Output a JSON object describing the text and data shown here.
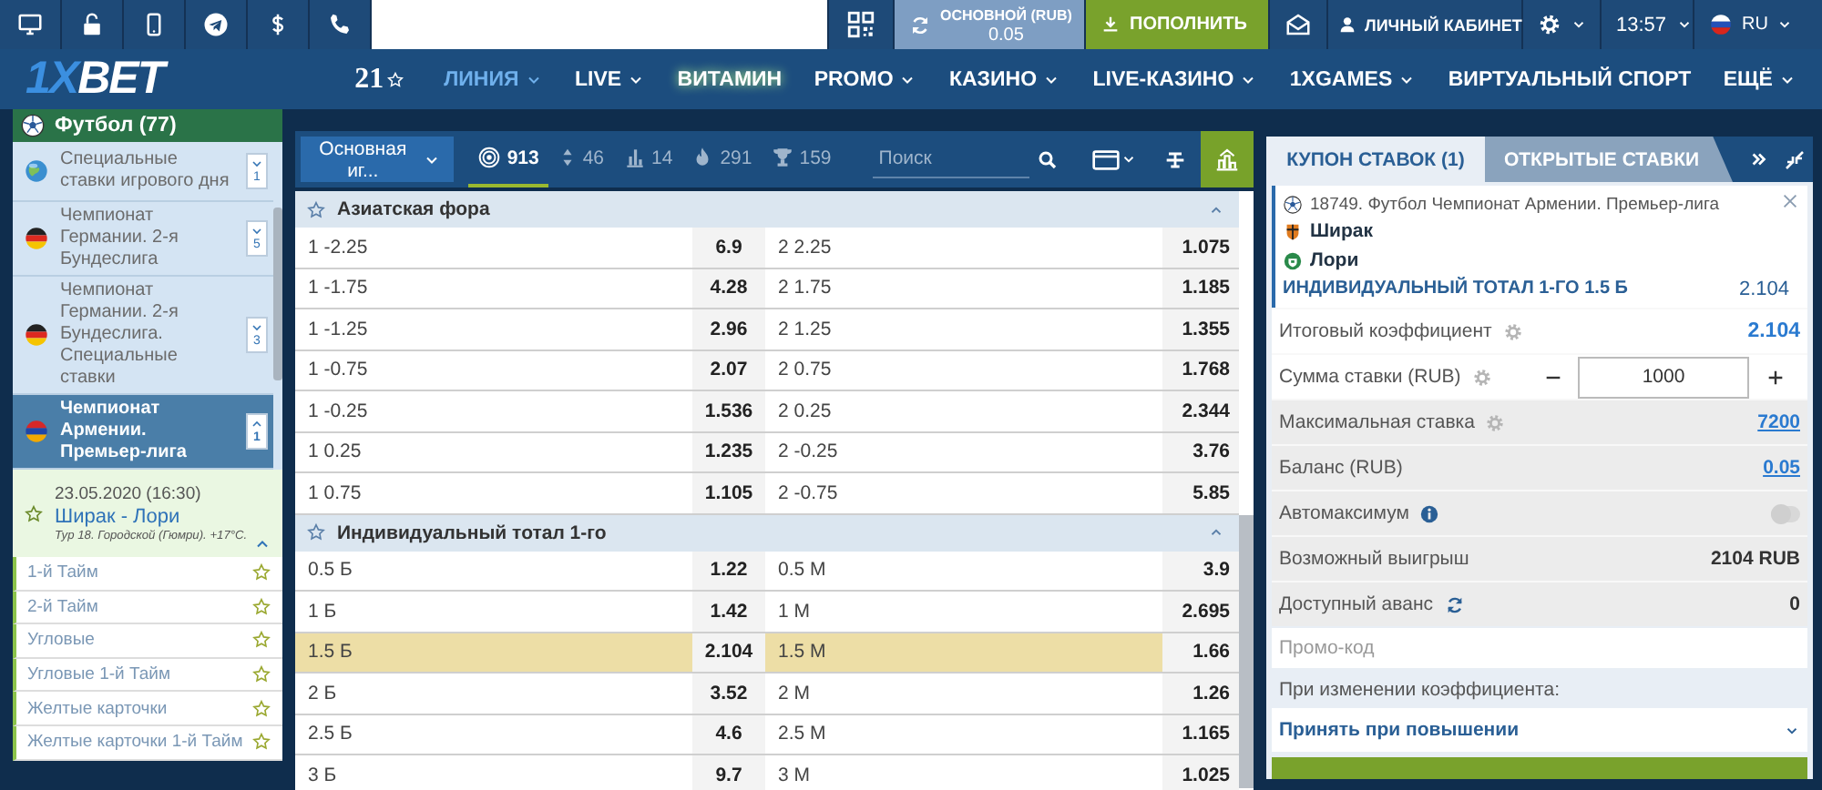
{
  "top_bar": {
    "balance": {
      "label": "ОСНОВНОЙ (RUB)",
      "value": "0.05"
    },
    "deposit": "ПОПОЛНИТЬ",
    "cabinet": "ЛИЧНЫЙ КАБИНЕТ",
    "time": "13:57",
    "language": "RU"
  },
  "nav": {
    "logo": {
      "accent": "1X",
      "rest": "BET"
    },
    "badge": "21",
    "items": [
      {
        "label": "ЛИНИЯ",
        "selected": true,
        "dropdown": true
      },
      {
        "label": "LIVE",
        "selected": false,
        "dropdown": true
      },
      {
        "label": "ВИТАМИН",
        "selected": false,
        "dropdown": false
      },
      {
        "label": "PROMO",
        "selected": false,
        "dropdown": true
      },
      {
        "label": "КАЗИНО",
        "selected": false,
        "dropdown": true
      },
      {
        "label": "LIVE-КАЗИНО",
        "selected": false,
        "dropdown": true
      },
      {
        "label": "1XGAMES",
        "selected": false,
        "dropdown": true
      },
      {
        "label": "ВИРТУАЛЬНЫЙ СПОРТ",
        "selected": false,
        "dropdown": false
      },
      {
        "label": "ЕЩЁ",
        "selected": false,
        "dropdown": true
      }
    ]
  },
  "sidebar": {
    "sport": "Футбол (77)",
    "leagues": [
      {
        "name": "Специальные ставки игрового дня",
        "kind": "globe",
        "count": "1",
        "expanded": false,
        "selected": false
      },
      {
        "name": "Чемпионат Германии. 2-я Бундеслига",
        "kind": "germany",
        "count": "5",
        "expanded": false,
        "selected": false
      },
      {
        "name": "Чемпионат Германии. 2-я Бундеслига. Специальные ставки",
        "kind": "germany",
        "count": "3",
        "expanded": false,
        "selected": false
      },
      {
        "name": "Чемпионат Армении. Премьер-лига",
        "kind": "armenia",
        "count": "1",
        "expanded": true,
        "selected": true
      }
    ],
    "match": {
      "date": "23.05.2020 (16:30)",
      "teams": "Ширак - Лори",
      "info": "Тур 18. Городской (Гюмри). +17°C."
    },
    "submarkets": [
      "1-й Тайм",
      "2-й Тайм",
      "Угловые",
      "Угловые 1-й Тайм",
      "Желтые карточки",
      "Желтые карточки 1-й Тайм"
    ]
  },
  "toolbar": {
    "mode": "Основная иг...",
    "filters": [
      {
        "kind": "target",
        "count": "913",
        "selected": true
      },
      {
        "kind": "updown",
        "count": "46",
        "selected": false
      },
      {
        "kind": "chart",
        "count": "14",
        "selected": false
      },
      {
        "kind": "fire",
        "count": "291",
        "selected": false
      },
      {
        "kind": "trophy",
        "count": "159",
        "selected": false
      }
    ],
    "search": {
      "placeholder": "Поиск"
    }
  },
  "markets": [
    {
      "title": "Азиатская фора",
      "expanded": true,
      "rows": [
        {
          "left": "1 -2.25",
          "left_odds": "6.9",
          "right": "2 2.25",
          "right_odds": "1.075",
          "selected": false
        },
        {
          "left": "1 -1.75",
          "left_odds": "4.28",
          "right": "2 1.75",
          "right_odds": "1.185",
          "selected": false
        },
        {
          "left": "1 -1.25",
          "left_odds": "2.96",
          "right": "2 1.25",
          "right_odds": "1.355",
          "selected": false
        },
        {
          "left": "1 -0.75",
          "left_odds": "2.07",
          "right": "2 0.75",
          "right_odds": "1.768",
          "selected": false
        },
        {
          "left": "1 -0.25",
          "left_odds": "1.536",
          "right": "2 0.25",
          "right_odds": "2.344",
          "selected": false
        },
        {
          "left": "1 0.25",
          "left_odds": "1.235",
          "right": "2 -0.25",
          "right_odds": "3.76",
          "selected": false
        },
        {
          "left": "1 0.75",
          "left_odds": "1.105",
          "right": "2 -0.75",
          "right_odds": "5.85",
          "selected": false
        }
      ]
    },
    {
      "title": "Индивидуальный тотал 1-го",
      "expanded": true,
      "rows": [
        {
          "left": "0.5 Б",
          "left_odds": "1.22",
          "right": "0.5 М",
          "right_odds": "3.9",
          "selected": false
        },
        {
          "left": "1 Б",
          "left_odds": "1.42",
          "right": "1 М",
          "right_odds": "2.695",
          "selected": false
        },
        {
          "left": "1.5 Б",
          "left_odds": "2.104",
          "right": "1.5 М",
          "right_odds": "1.66",
          "selected": true
        },
        {
          "left": "2 Б",
          "left_odds": "3.52",
          "right": "2 М",
          "right_odds": "1.26",
          "selected": false
        },
        {
          "left": "2.5 Б",
          "left_odds": "4.6",
          "right": "2.5 М",
          "right_odds": "1.165",
          "selected": false
        },
        {
          "left": "3 Б",
          "left_odds": "9.7",
          "right": "3 М",
          "right_odds": "1.025",
          "selected": false
        }
      ]
    }
  ],
  "bet_slip": {
    "tabs": [
      {
        "label": "КУПОН СТАВОК (1)",
        "selected": true
      },
      {
        "label": "ОТКРЫТЫЕ СТАВКИ",
        "selected": false
      }
    ],
    "bet": {
      "event": "18749. Футбол Чемпионат Армении. Премьер-лига",
      "team_1": "Ширак",
      "team_2": "Лори",
      "selection": "ИНДИВИДУАЛЬНЫЙ ТОТАЛ 1-ГО 1.5 Б",
      "odds": "2.104"
    },
    "rows": [
      {
        "kind": "odds",
        "label": "Итоговый коэффициент",
        "value": "2.104"
      },
      {
        "kind": "stake",
        "label": "Сумма ставки (RUB)",
        "value": "1000"
      },
      {
        "kind": "link",
        "label": "Максимальная ставка",
        "value": "7200"
      },
      {
        "kind": "link",
        "label": "Баланс (RUB)",
        "value": "0.05"
      },
      {
        "kind": "toggle",
        "label": "Автомаксимум",
        "on": false
      },
      {
        "kind": "value",
        "label": "Возможный выигрыш",
        "value": "2104 RUB"
      },
      {
        "kind": "value",
        "label": "Доступный аванс",
        "value": "0"
      }
    ],
    "promo": {
      "placeholder": "Промо-код"
    },
    "odds_change_label": "При изменении коэффициента:",
    "odds_change": "Принять при повышении"
  }
}
